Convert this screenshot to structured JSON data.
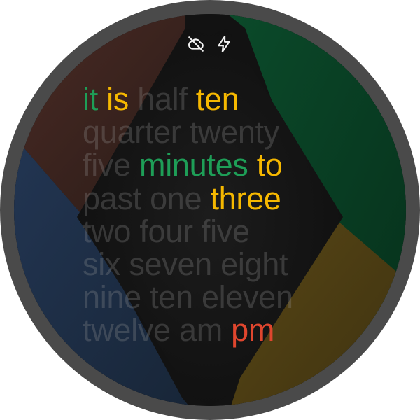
{
  "status_icons": [
    "cloud-off-icon",
    "charging-bolt-icon"
  ],
  "colors": {
    "inactive": "#969696",
    "green": "#1e9e57",
    "yellow": "#f6b800",
    "red": "#e0462e",
    "quad_top_left": "#3a2622",
    "quad_top_right": "#0c3a22",
    "quad_bottom_left": "#1c2a40",
    "quad_bottom_right": "#4a3a14"
  },
  "rows": [
    [
      {
        "text": "it",
        "active": "green"
      },
      {
        "text": "is",
        "active": "yellow"
      },
      {
        "text": "half",
        "active": null
      },
      {
        "text": "ten",
        "active": "yellow"
      }
    ],
    [
      {
        "text": "quarter",
        "active": null
      },
      {
        "text": "twenty",
        "active": null
      }
    ],
    [
      {
        "text": "five",
        "active": null
      },
      {
        "text": "minutes",
        "active": "green"
      },
      {
        "text": "to",
        "active": "yellow"
      }
    ],
    [
      {
        "text": "past",
        "active": null
      },
      {
        "text": "one",
        "active": null
      },
      {
        "text": "three",
        "active": "yellow"
      }
    ],
    [
      {
        "text": "two",
        "active": null
      },
      {
        "text": "four",
        "active": null
      },
      {
        "text": "five",
        "active": null
      }
    ],
    [
      {
        "text": "six",
        "active": null
      },
      {
        "text": "seven",
        "active": null
      },
      {
        "text": "eight",
        "active": null
      }
    ],
    [
      {
        "text": "nine",
        "active": null
      },
      {
        "text": "ten",
        "active": null
      },
      {
        "text": "eleven",
        "active": null
      }
    ],
    [
      {
        "text": "twelve",
        "active": null
      },
      {
        "text": "am",
        "active": null
      },
      {
        "text": "pm",
        "active": "red"
      }
    ]
  ]
}
